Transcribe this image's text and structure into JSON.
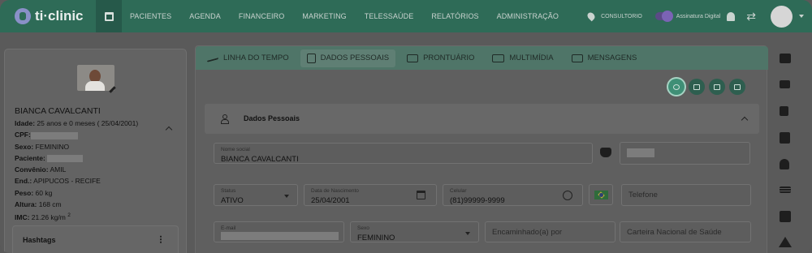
{
  "brand": {
    "name": "ti·clinic"
  },
  "nav": [
    "PACIENTES",
    "AGENDA",
    "FINANCEIRO",
    "MARKETING",
    "TELESSAÚDE",
    "RELATÓRIOS",
    "ADMINISTRAÇÃO"
  ],
  "topright": {
    "location": "CONSULTORIO",
    "signature": "Assinatura Digital"
  },
  "patient": {
    "name": "BIANCA CAVALCANTI",
    "idade_label": "Idade:",
    "idade_value": "25 anos e 0 meses ( 25/04/2001)",
    "cpf_label": "CPF:",
    "sexo_label": "Sexo:",
    "sexo_value": "FEMININO",
    "paciente_label": "Paciente:",
    "convenio_label": "Convênio:",
    "convenio_value": "AMIL",
    "end_label": "End.:",
    "end_value": "APIPUCOS -  RECIFE",
    "peso_label": "Peso:",
    "peso_value": "60 kg",
    "altura_label": "Altura:",
    "altura_value": "168 cm",
    "imc_label": "IMC:",
    "imc_value": "21.26 kg/m",
    "imc_sup": "2"
  },
  "hashtags": {
    "title": "Hashtags"
  },
  "tabs": [
    {
      "label": "LINHA DO TEMPO",
      "icon": "timeline-icon"
    },
    {
      "label": "DADOS PESSOAIS",
      "icon": "id-card-icon",
      "active": true
    },
    {
      "label": "PRONTUÁRIO",
      "icon": "medical-record-icon"
    },
    {
      "label": "MULTIMÍDIA",
      "icon": "images-icon"
    },
    {
      "label": "MENSAGENS",
      "icon": "mail-icon"
    }
  ],
  "section": {
    "title": "Dados Pessoais"
  },
  "form": {
    "nome_social_label": "Nome social",
    "nome_social_value": "BIANCA CAVALCANTI",
    "status_label": "Status",
    "status_value": "ATIVO",
    "nascimento_label": "Data de Nascimento",
    "nascimento_value": "25/04/2001",
    "celular_label": "Celular",
    "celular_value": "(81)99999-9999",
    "telefone_placeholder": "Telefone",
    "email_label": "E-mail",
    "sexo_label": "Sexo",
    "sexo_value": "FEMININO",
    "encaminhado_placeholder": "Encaminhado(a) por",
    "cns_placeholder": "Carteira Nacional de Saúde"
  },
  "colors": {
    "header": "#2e6b57",
    "tabbar": "#4f7568",
    "accent": "#3f8f76"
  }
}
